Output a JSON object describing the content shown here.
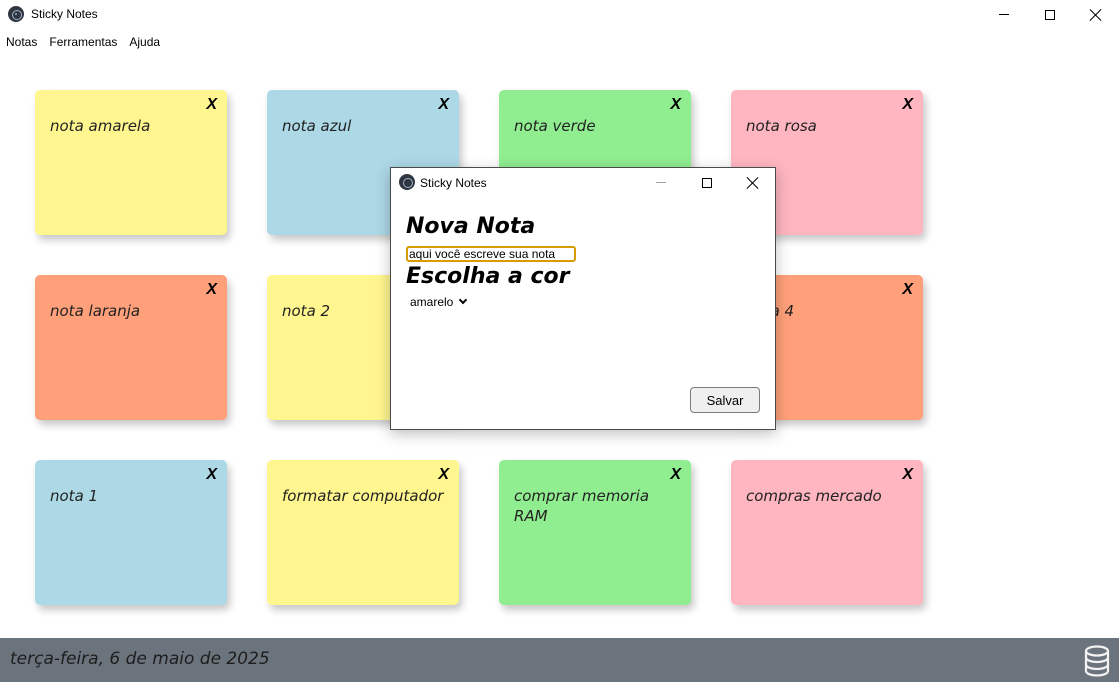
{
  "window": {
    "title": "Sticky Notes"
  },
  "menu": {
    "items": [
      "Notas",
      "Ferramentas",
      "Ajuda"
    ]
  },
  "notes": [
    {
      "text": "nota amarela",
      "color": "#fff68f",
      "close": "X"
    },
    {
      "text": "nota azul",
      "color": "#add8e6",
      "close": "X"
    },
    {
      "text": "nota verde",
      "color": "#90ee90",
      "close": "X"
    },
    {
      "text": "nota rosa",
      "color": "#ffb6c1",
      "close": "X"
    },
    {
      "text": "nota laranja",
      "color": "#ffa07a",
      "close": "X"
    },
    {
      "text": "nota 2",
      "color": "#fff68f",
      "close": "X"
    },
    {
      "text": "nota 4",
      "color": "#ffa07a",
      "close": "X"
    },
    {
      "text": "nota 1",
      "color": "#add8e6",
      "close": "X"
    },
    {
      "text": "formatar computador",
      "color": "#fff68f",
      "close": "X"
    },
    {
      "text": "comprar memoria RAM",
      "color": "#90ee90",
      "close": "X"
    },
    {
      "text": "compras mercado",
      "color": "#ffb6c1",
      "close": "X"
    }
  ],
  "footer": {
    "date": "terça-feira, 6 de maio de 2025",
    "icon": "database-icon"
  },
  "dialog": {
    "title": "Sticky Notes",
    "heading_new": "Nova Nota",
    "input_value": "aqui você escreve sua nota",
    "heading_color": "Escolha a cor",
    "select_value": "amarelo",
    "save_label": "Salvar"
  }
}
